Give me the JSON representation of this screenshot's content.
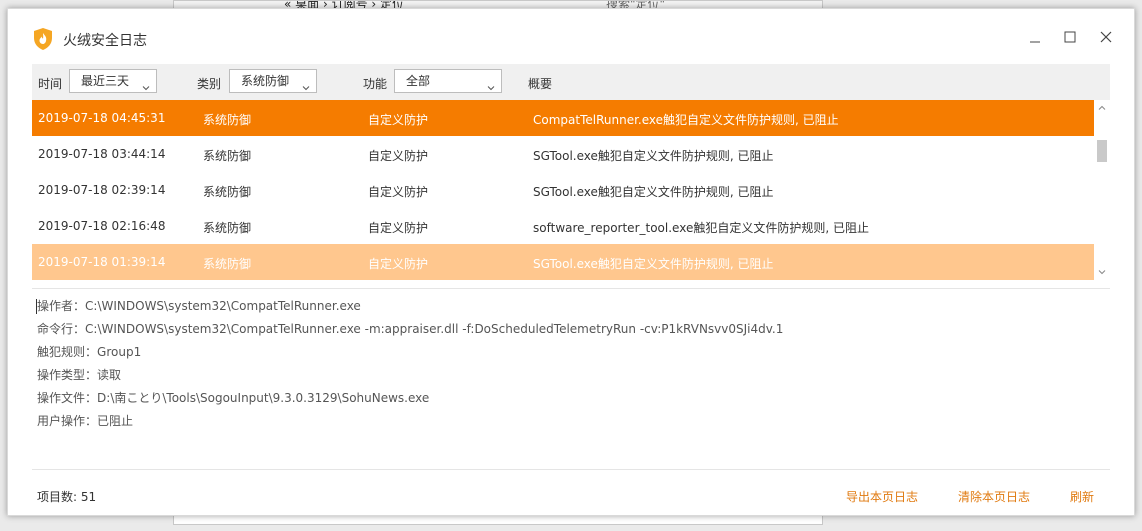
{
  "background_window": {
    "address": "« 桌面 › 订阅号 › 定位",
    "search_placeholder": "搜索\"定位\""
  },
  "app": {
    "title": "火绒安全日志",
    "logo_icon": "huorong-flame-shield-icon",
    "accent_color": "#f57c00",
    "hover_color": "#ffc78e"
  },
  "filters": {
    "time_label": "时间",
    "time_value": "最近三天",
    "category_label": "类别",
    "category_value": "系统防御",
    "function_label": "功能",
    "function_value": "全部",
    "summary_label": "概要"
  },
  "logs": [
    {
      "time": "2019-07-18 04:45:31",
      "category": "系统防御",
      "function": "自定义防护",
      "summary": "CompatTelRunner.exe触犯自定义文件防护规则, 已阻止",
      "state": "selected"
    },
    {
      "time": "2019-07-18 03:44:14",
      "category": "系统防御",
      "function": "自定义防护",
      "summary": "SGTool.exe触犯自定义文件防护规则, 已阻止",
      "state": "normal"
    },
    {
      "time": "2019-07-18 02:39:14",
      "category": "系统防御",
      "function": "自定义防护",
      "summary": "SGTool.exe触犯自定义文件防护规则, 已阻止",
      "state": "normal"
    },
    {
      "time": "2019-07-18 02:16:48",
      "category": "系统防御",
      "function": "自定义防护",
      "summary": "software_reporter_tool.exe触犯自定义文件防护规则, 已阻止",
      "state": "normal"
    },
    {
      "time": "2019-07-18 01:39:14",
      "category": "系统防御",
      "function": "自定义防护",
      "summary": "SGTool.exe触犯自定义文件防护规则, 已阻止",
      "state": "hover"
    }
  ],
  "details": [
    {
      "label": "操作者",
      "value": "C:\\WINDOWS\\system32\\CompatTelRunner.exe"
    },
    {
      "label": "命令行",
      "value": "C:\\WINDOWS\\system32\\CompatTelRunner.exe -m:appraiser.dll -f:DoScheduledTelemetryRun -cv:P1kRVNsvv0SJi4dv.1"
    },
    {
      "label": "触犯规则",
      "value": "Group1"
    },
    {
      "label": "操作类型",
      "value": "读取"
    },
    {
      "label": "操作文件",
      "value": "D:\\南ことり\\Tools\\SogouInput\\9.3.0.3129\\SohuNews.exe"
    },
    {
      "label": "用户操作",
      "value": "已阻止"
    }
  ],
  "footer": {
    "count_label": "项目数: 51",
    "export_label": "导出本页日志",
    "clear_label": "清除本页日志",
    "refresh_label": "刷新"
  }
}
